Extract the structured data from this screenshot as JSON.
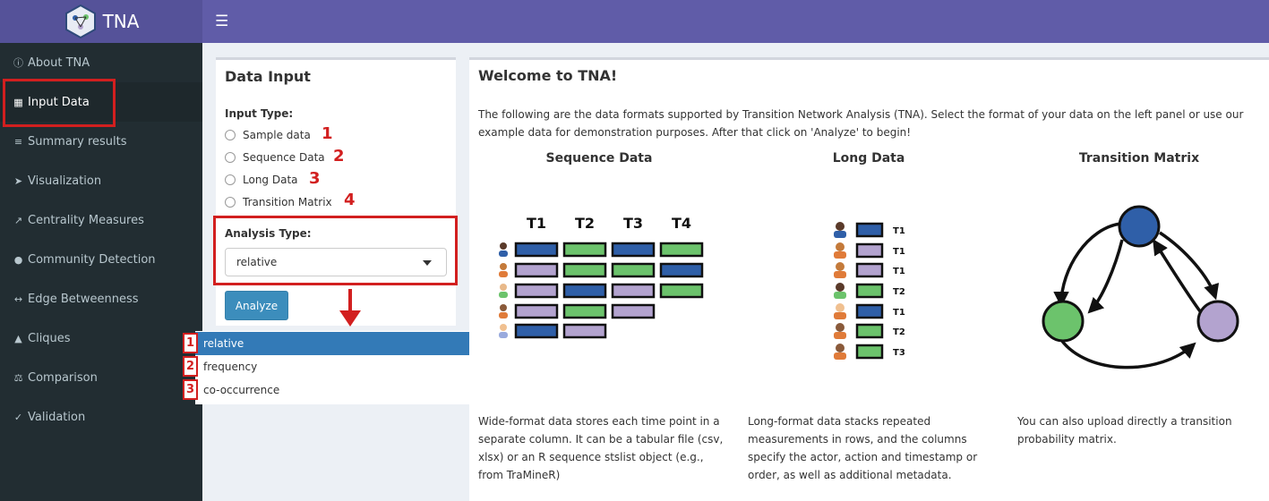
{
  "brand": {
    "title": "TNA"
  },
  "sidebar": {
    "items": [
      {
        "label": "About TNA",
        "icon": "info-circle-icon"
      },
      {
        "label": "Input Data",
        "icon": "table-icon"
      },
      {
        "label": "Summary results",
        "icon": "list-chart-icon"
      },
      {
        "label": "Visualization",
        "icon": "paper-plane-icon"
      },
      {
        "label": "Centrality Measures",
        "icon": "line-chart-icon"
      },
      {
        "label": "Community Detection",
        "icon": "users-icon"
      },
      {
        "label": "Edge Betweenness",
        "icon": "people-arrows-icon"
      },
      {
        "label": "Cliques",
        "icon": "sitemap-icon"
      },
      {
        "label": "Comparison",
        "icon": "balance-scale-icon"
      },
      {
        "label": "Validation",
        "icon": "check-circle-icon"
      }
    ]
  },
  "input_panel": {
    "title": "Data Input",
    "input_type_label": "Input Type:",
    "options": [
      "Sample data",
      "Sequence Data",
      "Long Data",
      "Transition Matrix"
    ],
    "option_numbers": [
      "1",
      "2",
      "3",
      "4"
    ],
    "analysis_type_label": "Analysis Type:",
    "analysis_type_value": "relative",
    "analyze_label": "Analyze"
  },
  "dropdown": {
    "options": [
      "relative",
      "frequency",
      "co-occurrence"
    ],
    "numbers": [
      "1",
      "2",
      "3"
    ]
  },
  "welcome": {
    "title": "Welcome to TNA!",
    "intro": "The following are the data formats supported by Transition Network Analysis (TNA). Select the format of your data on the left panel or use our example data for demonstration purposes. After that click on 'Analyze' to begin!",
    "sequence": {
      "title": "Sequence Data",
      "headers": [
        "T1",
        "T2",
        "T3",
        "T4"
      ],
      "description": "Wide-format data stores each time point in a separate column. It can be a tabular file (csv, xlsx) or an R sequence stslist object (e.g., from TraMineR)"
    },
    "long": {
      "title": "Long Data",
      "labels": [
        "T1",
        "T1",
        "T1",
        "T2",
        "T1",
        "T2",
        "T3"
      ],
      "description": "Long-format data stacks repeated measurements in rows, and the columns specify the actor, action and timestamp or order, as well as additional metadata."
    },
    "matrix": {
      "title": "Transition Matrix",
      "description": "You can also upload directly a transition probability matrix."
    }
  },
  "colors": {
    "blue": "#2f5fa8",
    "green": "#6cc36c",
    "purple": "#b3a3cf",
    "accent": "#d21f1f",
    "header": "#605ca8"
  }
}
